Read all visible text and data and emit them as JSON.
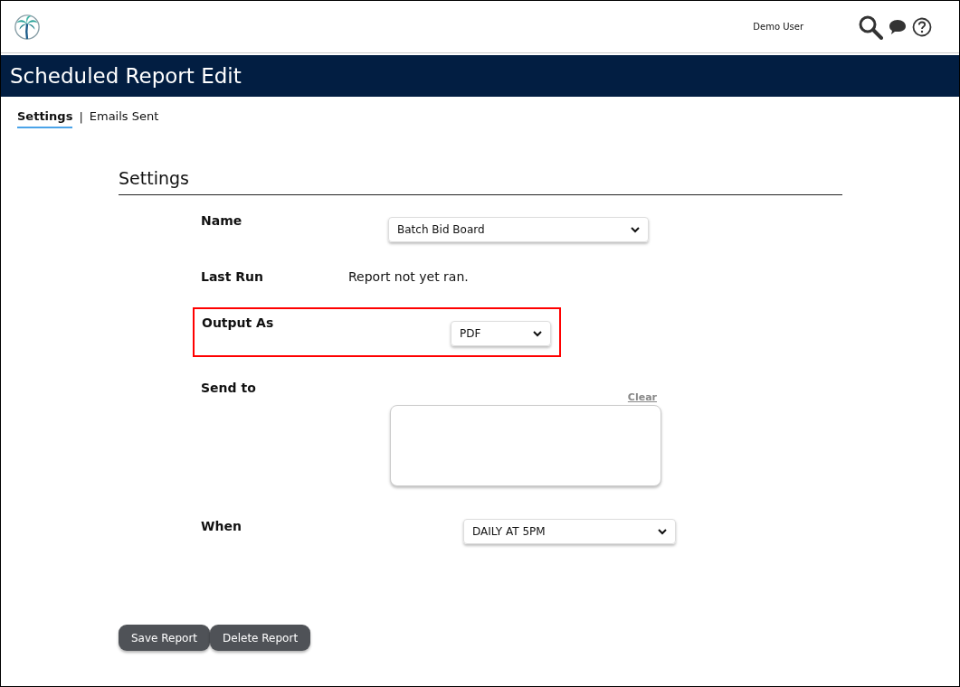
{
  "header": {
    "user_name": "Demo User"
  },
  "page_title": "Scheduled Report Edit",
  "tabs": [
    {
      "label": "Settings",
      "selected": true
    },
    {
      "label": "Emails Sent",
      "selected": false
    }
  ],
  "tab_separator": "|",
  "section_title": "Settings",
  "fields": [
    {
      "kind": "select",
      "label": "Name",
      "value": "Batch Bid Board",
      "highlighted": false
    },
    {
      "kind": "text",
      "label": "Last Run",
      "value": "Report not yet ran.",
      "highlighted": false
    },
    {
      "kind": "select",
      "label": "Output As",
      "value": "PDF",
      "highlighted": true
    },
    {
      "kind": "textarea",
      "label": "Send to",
      "action": "Clear",
      "highlighted": false
    },
    {
      "kind": "select",
      "label": "When",
      "value": "DAILY AT 5PM",
      "highlighted": false
    }
  ],
  "buttons": [
    "Save Report",
    "Delete Report"
  ]
}
